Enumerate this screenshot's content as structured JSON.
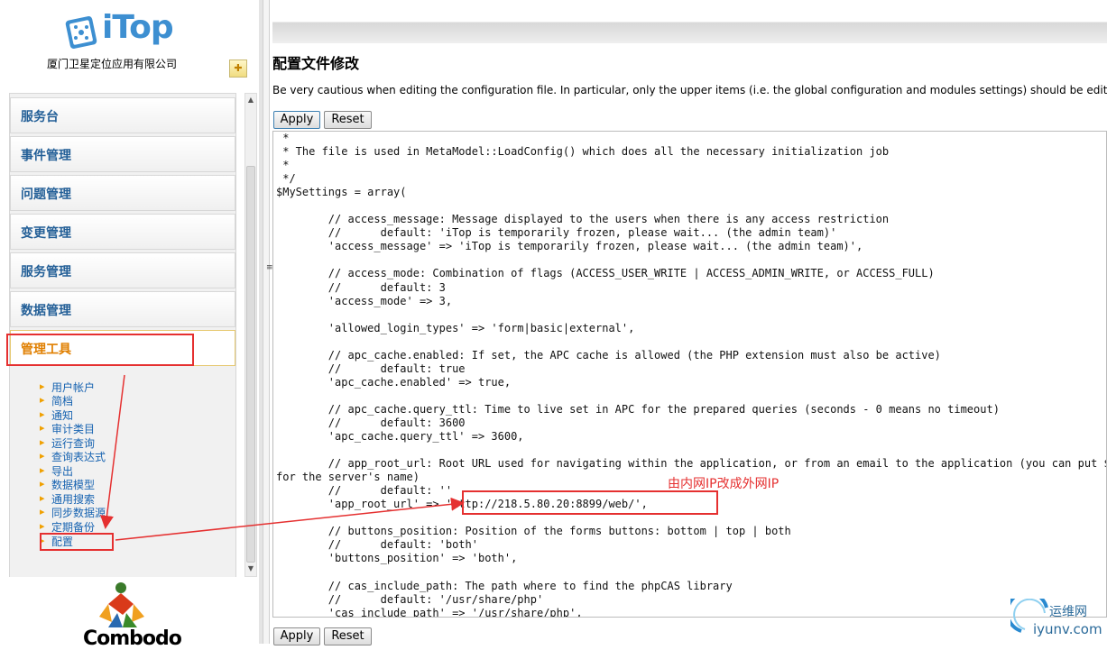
{
  "sidebar": {
    "logo_text": "iTop",
    "company": "厦门卫星定位应用有限公司",
    "pin_icon": "pin-icon",
    "menu": [
      "服务台",
      "事件管理",
      "问题管理",
      "变更管理",
      "服务管理",
      "数据管理",
      "管理工具"
    ],
    "submenu": [
      "用户帐户",
      "简档",
      "通知",
      "审计类目",
      "运行查询",
      "查询表达式",
      "导出",
      "数据模型",
      "通用搜索",
      "同步数据源",
      "定期备份",
      "配置"
    ],
    "footer_logo": "Combodo"
  },
  "main": {
    "title": "配置文件修改",
    "description": "Be very cautious when editing the configuration file. In particular, only the upper items (i.e. the global configuration and modules settings) should be edited.",
    "apply_label": "Apply",
    "reset_label": "Reset",
    "code_lines": [
      " *",
      " * The file is used in MetaModel::LoadConfig() which does all the necessary initialization job",
      " *",
      " */",
      "$MySettings = array(",
      "",
      "        // access_message: Message displayed to the users when there is any access restriction",
      "        //      default: 'iTop is temporarily frozen, please wait... (the admin team)'",
      "        'access_message' => 'iTop is temporarily frozen, please wait... (the admin team)',",
      "",
      "        // access_mode: Combination of flags (ACCESS_USER_WRITE | ACCESS_ADMIN_WRITE, or ACCESS_FULL)",
      "        //      default: 3",
      "        'access_mode' => 3,",
      "",
      "        'allowed_login_types' => 'form|basic|external',",
      "",
      "        // apc_cache.enabled: If set, the APC cache is allowed (the PHP extension must also be active)",
      "        //      default: true",
      "        'apc_cache.enabled' => true,",
      "",
      "        // apc_cache.query_ttl: Time to live set in APC for the prepared queries (seconds - 0 means no timeout)",
      "        //      default: 3600",
      "        'apc_cache.query_ttl' => 3600,",
      "",
      "        // app_root_url: Root URL used for navigating within the application, or from an email to the application (you can put $SERVER_NAME$ as a placeholder for the server's name)",
      "for the server's name)",
      "        //      default: ''",
      "        'app_root_url' => 'http://218.5.80.20:8899/web/',",
      "",
      "        // buttons_position: Position of the forms buttons: bottom | top | both",
      "        //      default: 'both'",
      "        'buttons_position' => 'both',",
      "",
      "        // cas_include_path: The path where to find the phpCAS library",
      "        //      default: '/usr/share/php'",
      "        'cas_include_path' => '/usr/share/php',"
    ]
  },
  "annotation": {
    "note": "由内网IP改成外网IP",
    "color": "#e53030"
  },
  "watermark": {
    "line1": "运维网",
    "line2": "iyunv.com"
  }
}
